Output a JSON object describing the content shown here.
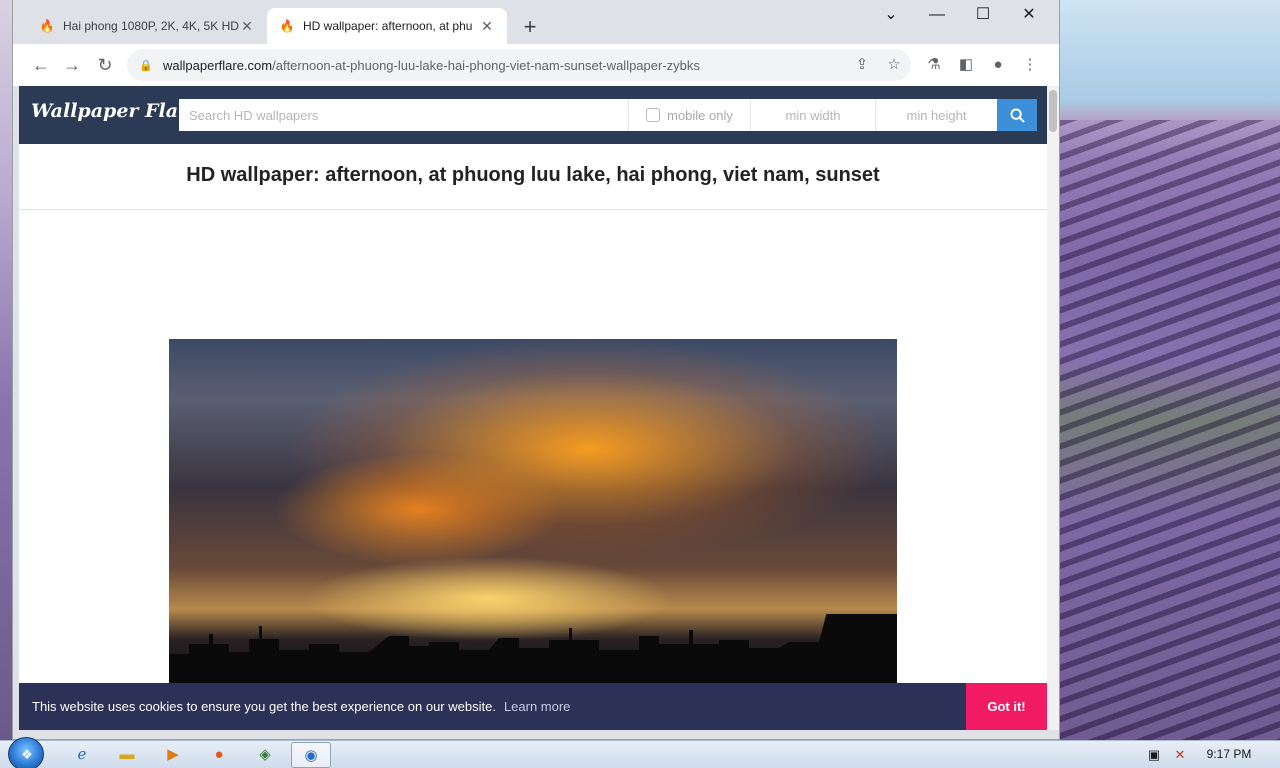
{
  "browser": {
    "tabs": [
      {
        "title": "Hai phong 1080P, 2K, 4K, 5K HD",
        "active": false
      },
      {
        "title": "HD wallpaper: afternoon, at phu",
        "active": true
      }
    ],
    "new_tab": "+",
    "window_controls": {
      "dropdown": "⌄",
      "minimize": "—",
      "maximize": "☐",
      "close": "✕"
    },
    "nav": {
      "back": "←",
      "forward": "→",
      "reload": "↻"
    },
    "address": {
      "host": "wallpaperflare.com",
      "path": "/afternoon-at-phuong-luu-lake-hai-phong-viet-nam-sunset-wallpaper-zybks"
    }
  },
  "site": {
    "logo": "Wallpaper Flare",
    "search": {
      "placeholder": "Search HD wallpapers",
      "mobile_only_label": "mobile only",
      "min_width_placeholder": "min width",
      "min_height_placeholder": "min height"
    },
    "page_title": "HD wallpaper: afternoon, at phuong luu lake, hai phong, viet nam, sunset"
  },
  "cookie_banner": {
    "message": "This website uses cookies to ensure you get the best experience on our website.",
    "learn_more": "Learn more",
    "accept": "Got it!"
  },
  "taskbar": {
    "clock": "9:17 PM"
  },
  "colors": {
    "site_header": "#2b3a55",
    "search_button": "#3d8fd9",
    "cookie_bar": "#2b3157",
    "got_it": "#f01b63"
  }
}
